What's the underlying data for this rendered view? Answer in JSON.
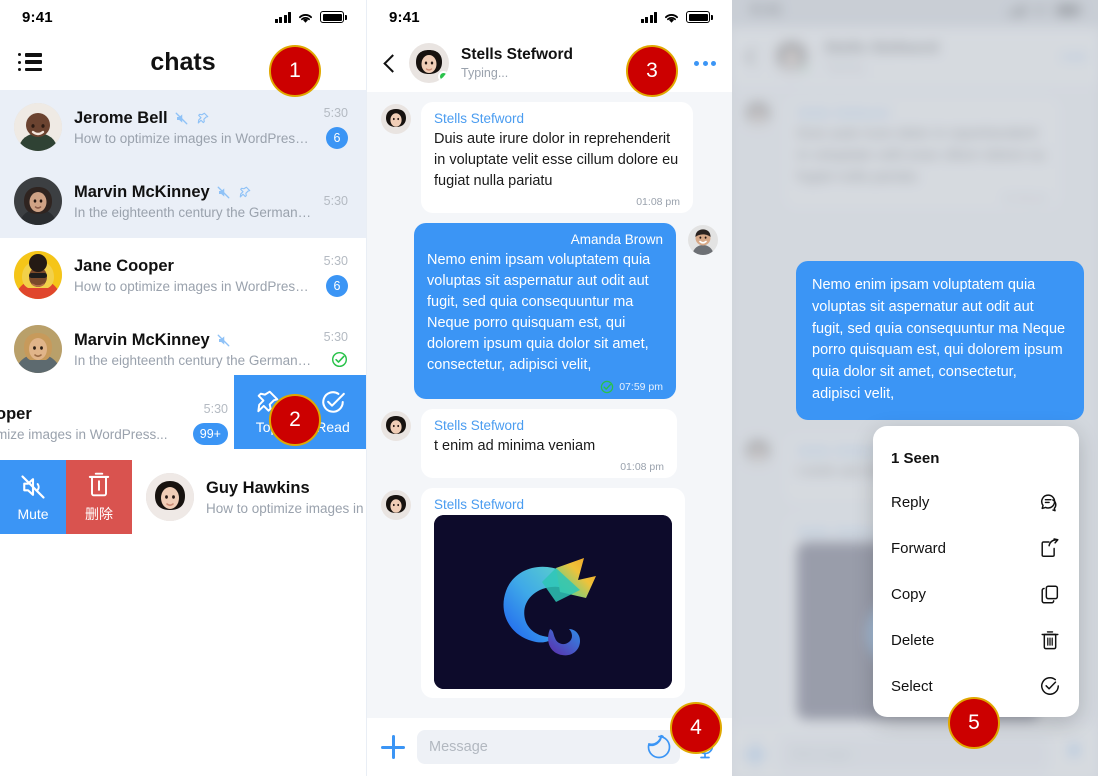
{
  "status_bar": {
    "time": "9:41"
  },
  "left_panel": {
    "menu_icon": "list-menu-icon",
    "title": "chats",
    "rows": [
      {
        "name": "Jerome Bell",
        "preview": "How to optimize images in WordPress for...",
        "time": "5:30",
        "badge": "6",
        "muted": true,
        "pinned": true,
        "selected": true,
        "avatar": "jerome"
      },
      {
        "name": "Marvin McKinney",
        "preview": "In the eighteenth century the German philosoph...",
        "time": "5:30",
        "badge": "",
        "muted": true,
        "pinned": true,
        "selected": true,
        "avatar": "marvin-f"
      },
      {
        "name": "Jane Cooper",
        "preview": "How to optimize images in WordPress for...",
        "time": "5:30",
        "badge": "6",
        "muted": false,
        "pinned": false,
        "selected": false,
        "avatar": "jane"
      },
      {
        "name": "Marvin McKinney",
        "preview": "In the eighteenth century the German philos...",
        "time": "5:30",
        "badge": "",
        "muted": true,
        "pinned": false,
        "selected": false,
        "read_tick": true,
        "avatar": "marvin-m"
      },
      {
        "name": "oper",
        "preview": "mize images in WordPress...",
        "time": "5:30",
        "badge": "99+",
        "muted": false,
        "pinned": false,
        "selected": false,
        "avatar": "none"
      },
      {
        "name": "Guy Hawkins",
        "preview": "How to optimize images in W",
        "time": "",
        "badge": "",
        "muted": false,
        "pinned": false,
        "selected": false,
        "avatar": "guy"
      }
    ],
    "swipe_right_actions": [
      {
        "label": "Top",
        "icon": "pin-icon"
      },
      {
        "label": "Read",
        "icon": "check-circle-icon"
      }
    ],
    "swipe_left_actions": [
      {
        "label": "Mute",
        "icon": "mute-icon"
      },
      {
        "label": "删除",
        "icon": "trash-icon"
      }
    ]
  },
  "mid_panel": {
    "header": {
      "back_icon": "back-chevron-icon",
      "name": "Stells Stefword",
      "status": "Typing...",
      "more_icon": "more-dots-icon"
    },
    "messages": [
      {
        "dir": "in",
        "name": "Stells Stefword",
        "text": "Duis aute irure dolor in reprehenderit in voluptate velit esse cillum dolore eu fugiat nulla pariatu",
        "time": "01:08 pm",
        "type": "text"
      },
      {
        "dir": "out",
        "name": "Amanda Brown",
        "text": "Nemo enim ipsam voluptatem quia voluptas sit aspernatur aut odit aut fugit, sed quia consequuntur ma Neque porro quisquam est, qui dolorem ipsum quia dolor sit amet, consectetur, adipisci velit,",
        "time": "07:59 pm",
        "type": "text",
        "read": true
      },
      {
        "dir": "in",
        "name": "Stells Stefword",
        "text": "t enim ad minima veniam",
        "time": "01:08 pm",
        "type": "text"
      },
      {
        "dir": "in",
        "name": "Stells Stefword",
        "text": "",
        "time": "",
        "type": "image",
        "image_alt": "chameleon-logo"
      }
    ],
    "composer": {
      "add_icon": "plus-icon",
      "placeholder": "Message",
      "sticker_icon": "sticker-icon",
      "mic_icon": "microphone-icon"
    }
  },
  "right_panel": {
    "highlighted_message": "Nemo enim ipsam voluptatem quia voluptas sit aspernatur aut odit aut fugit, sed quia consequuntur ma Neque porro quisquam est, qui dolorem ipsum quia dolor sit amet, consectetur, adipisci velit,",
    "context_menu": {
      "seen_label": "1 Seen",
      "items": [
        {
          "label": "Reply",
          "icon": "reply-icon"
        },
        {
          "label": "Forward",
          "icon": "forward-icon"
        },
        {
          "label": "Copy",
          "icon": "copy-icon"
        },
        {
          "label": "Delete",
          "icon": "trash-icon"
        },
        {
          "label": "Select",
          "icon": "check-circle-icon"
        }
      ]
    }
  },
  "steps": [
    {
      "n": "1"
    },
    {
      "n": "2"
    },
    {
      "n": "3"
    },
    {
      "n": "4"
    },
    {
      "n": "5"
    }
  ],
  "colors": {
    "accent_blue": "#3b95f5",
    "badge_red": "#cc0000",
    "badge_ring": "#e0a800",
    "delete_red": "#d9534f",
    "read_green": "#29c24a",
    "selected_row": "#eaeff7",
    "chat_bg": "#f4f6f9"
  }
}
